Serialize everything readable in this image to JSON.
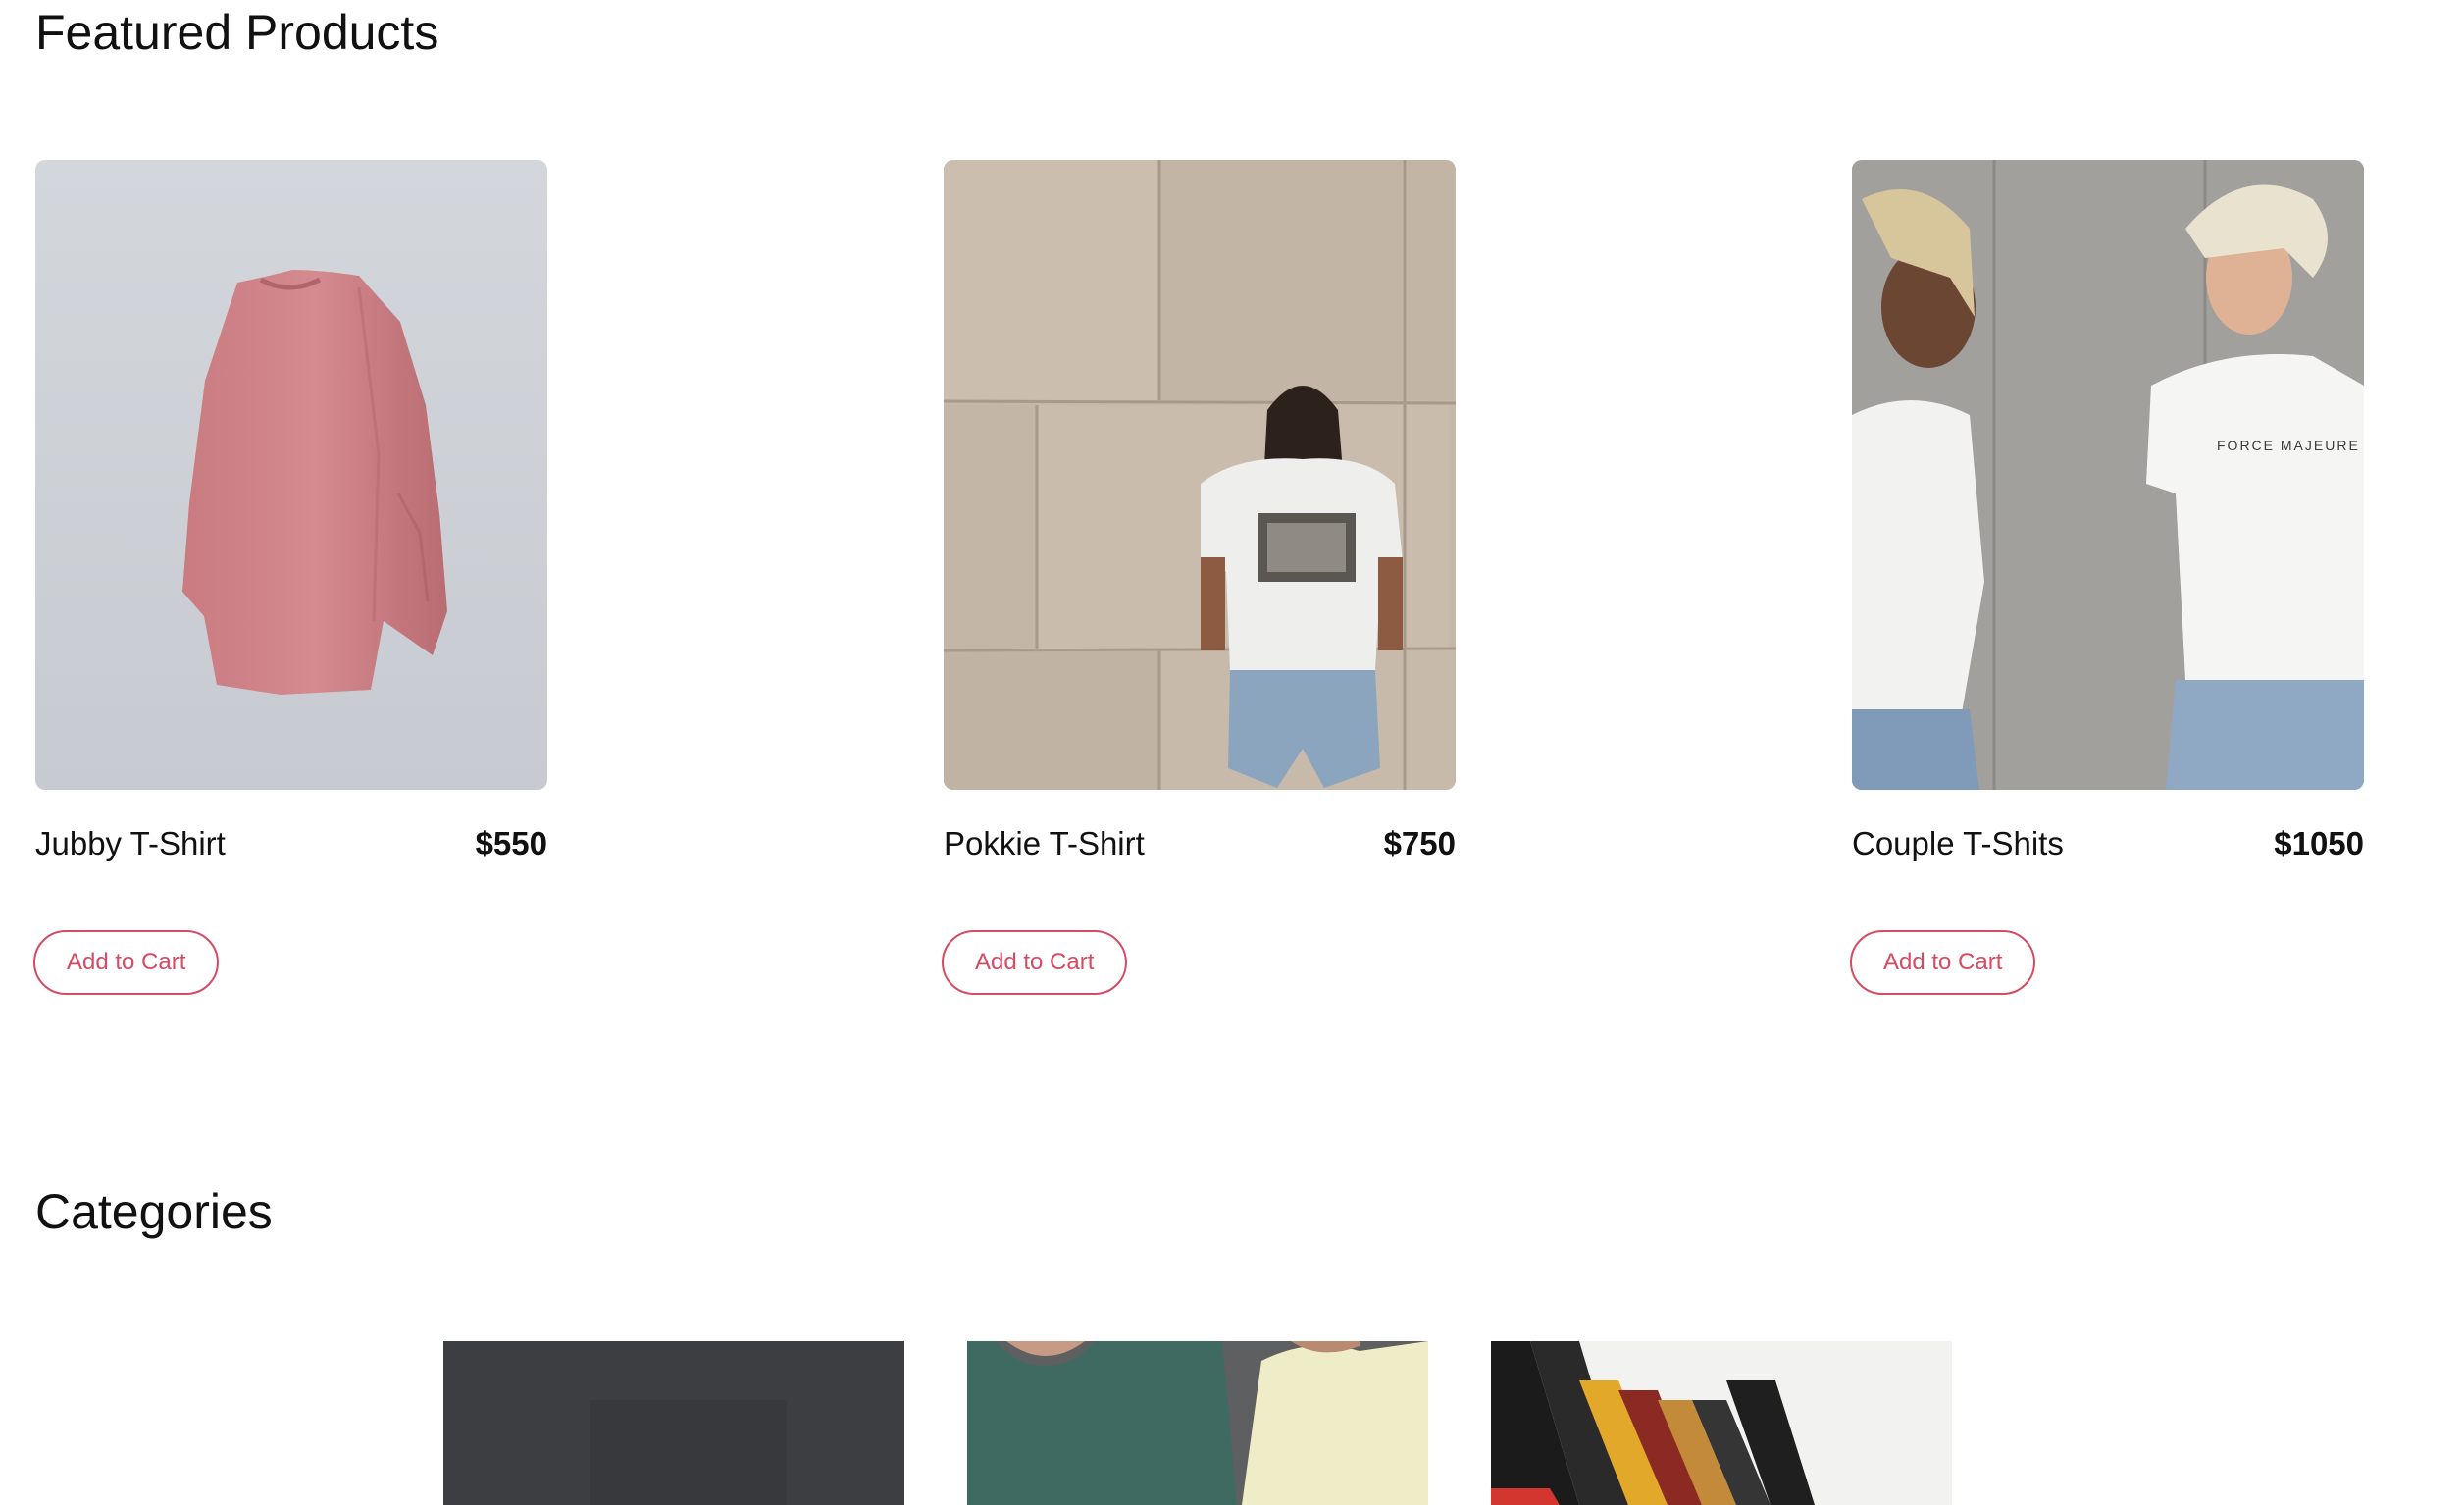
{
  "featured": {
    "title": "Featured Products",
    "products": [
      {
        "name": "Jubby T-Shirt",
        "price": "$550",
        "cart_label": "Add to Cart",
        "image": "pink-oversized-tshirt-photo"
      },
      {
        "name": "Pokkie T-Shirt",
        "price": "$750",
        "cart_label": "Add to Cart",
        "image": "man-white-tshirt-against-stone-wall-photo"
      },
      {
        "name": "Couple T-Shits",
        "price": "$1050",
        "cart_label": "Add to Cart",
        "image": "couple-white-tshirts-concrete-wall-photo",
        "image_text": "FORCE MAJEURE"
      }
    ]
  },
  "categories": {
    "title": "Categories",
    "tiles": [
      {
        "image": "dark-gray-fabric-photo"
      },
      {
        "image": "green-and-cream-tshirts-photo"
      },
      {
        "image": "tshirts-on-hangers-photo"
      }
    ]
  },
  "colors": {
    "accent": "#d64a62",
    "text": "#111111",
    "background": "#ffffff"
  }
}
